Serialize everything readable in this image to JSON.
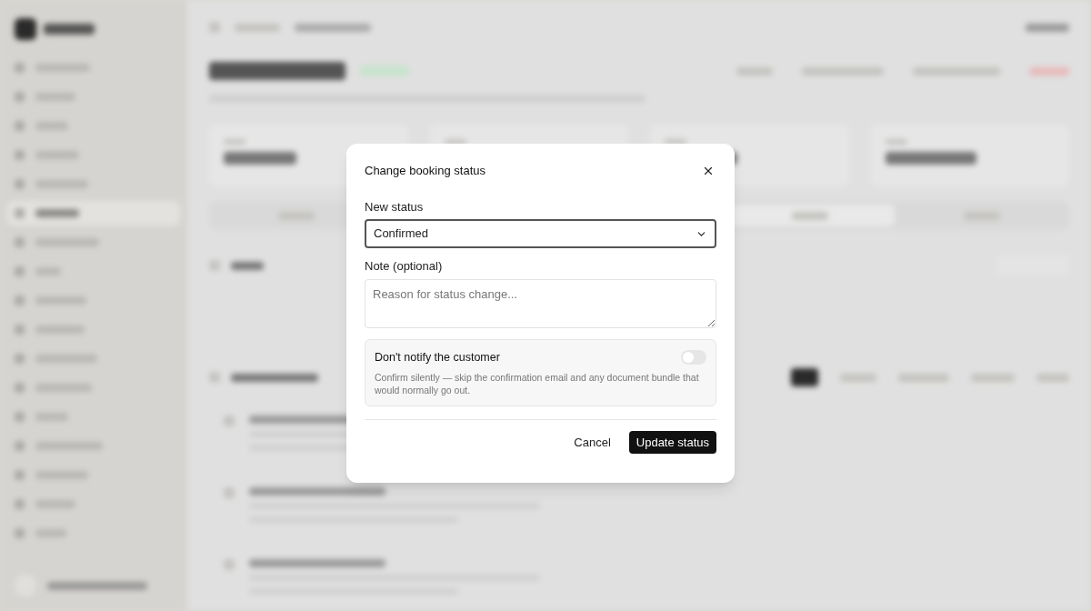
{
  "dialog": {
    "title": "Change booking status",
    "status_label": "New status",
    "status_value": "Confirmed",
    "note_label": "Note (optional)",
    "note_placeholder": "Reason for status change...",
    "silent": {
      "title": "Don't notify the customer",
      "description": "Confirm silently — skip the confirmation email and any document bundle that would normally go out.",
      "on": false
    },
    "cancel": "Cancel",
    "submit": "Update status"
  }
}
